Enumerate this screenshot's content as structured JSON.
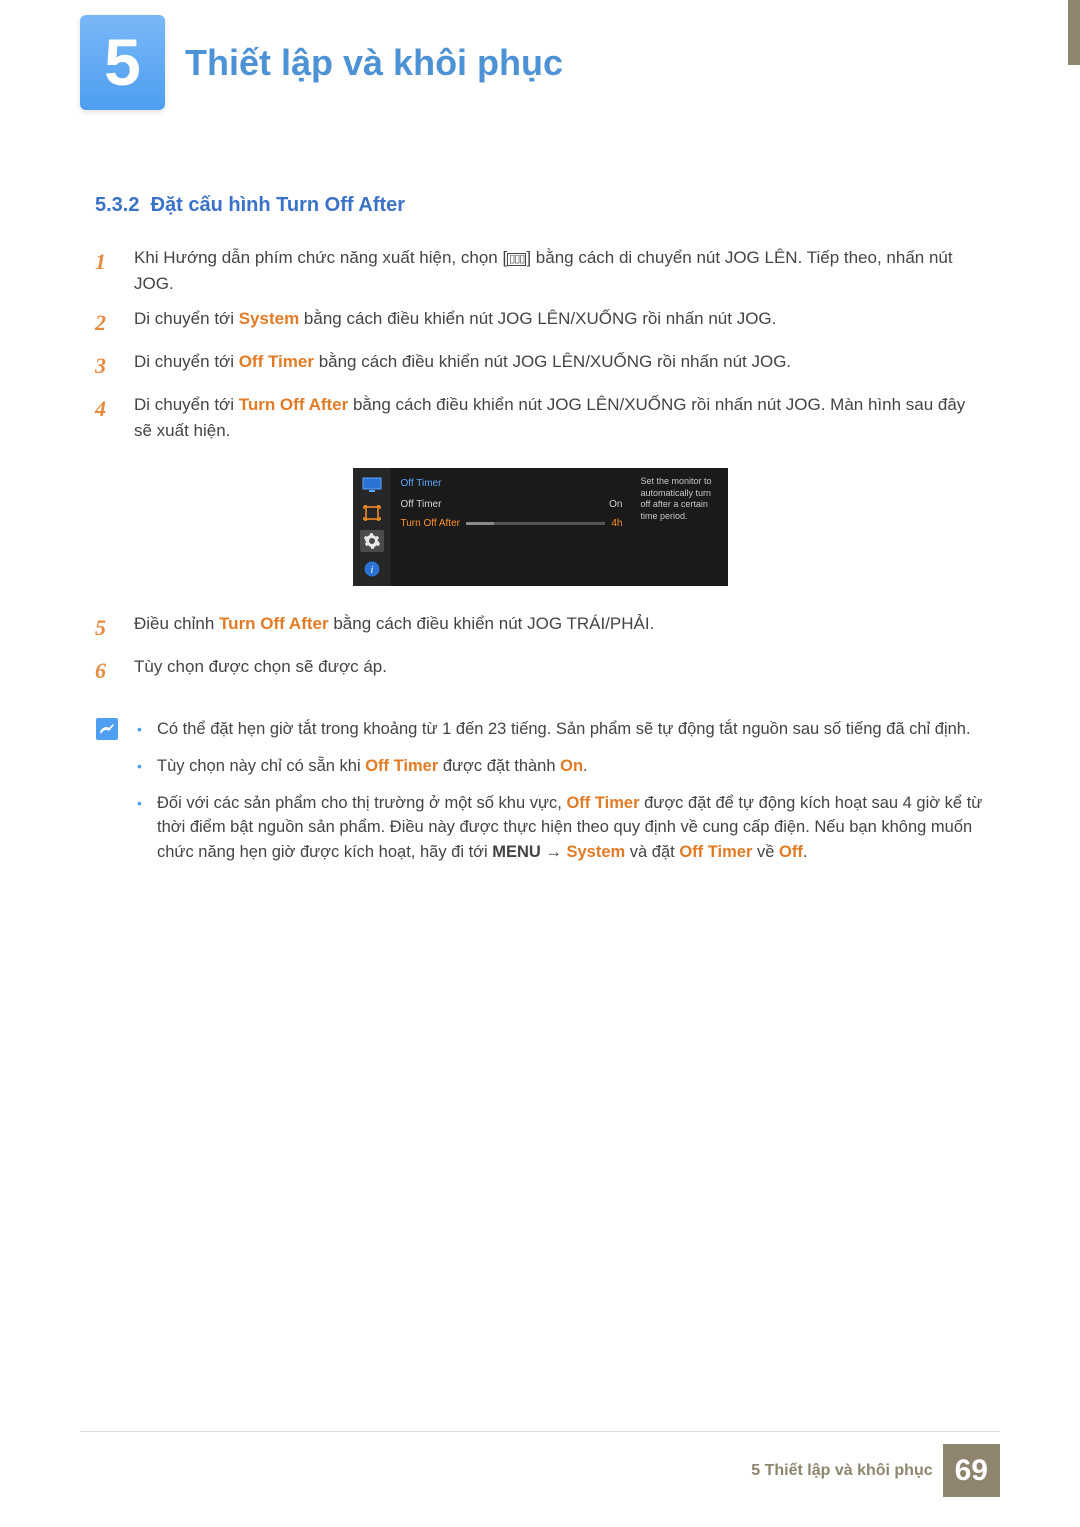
{
  "chapter": {
    "number": "5",
    "title": "Thiết lập và khôi phục"
  },
  "section": {
    "number": "5.3.2",
    "title": "Đặt cấu hình Turn Off After"
  },
  "steps": {
    "s1a": "Khi Hướng dẫn phím chức năng xuất hiện, chọn [",
    "s1b": "] bằng cách di chuyển nút JOG LÊN. Tiếp theo, nhấn nút JOG.",
    "s2a": "Di chuyển tới ",
    "s2b": " bằng cách điều khiển nút JOG LÊN/XUỐNG rồi nhấn nút JOG.",
    "s2_accent": "System",
    "s3a": "Di chuyển tới ",
    "s3_accent": "Off Timer",
    "s3b": " bằng cách điều khiển nút JOG LÊN/XUỐNG rồi nhấn nút JOG.",
    "s4a": "Di chuyển tới ",
    "s4_accent": "Turn Off After",
    "s4b": " bằng cách điều khiển nút JOG LÊN/XUỐNG rồi nhấn nút JOG. Màn hình sau đây sẽ xuất hiện.",
    "s5a": "Điều chỉnh ",
    "s5_accent": "Turn Off After",
    "s5b": " bằng cách điều khiển nút JOG TRÁI/PHẢI.",
    "s6": "Tùy chọn được chọn sẽ được áp."
  },
  "osd": {
    "heading": "Off Timer",
    "row1_label": "Off Timer",
    "row1_value": "On",
    "row2_label": "Turn Off After",
    "row2_value": "4h",
    "desc": "Set the monitor to automatically turn off after a certain time period."
  },
  "notes": {
    "n1": "Có thể đặt hẹn giờ tắt trong khoảng từ 1 đến 23 tiếng. Sản phẩm sẽ tự động tắt nguồn sau số tiếng đã chỉ định.",
    "n2a": "Tùy chọn này chỉ có sẵn khi ",
    "n2_off_timer": "Off Timer",
    "n2b": " được đặt thành ",
    "n2_on": "On",
    "n2c": ".",
    "n3a": "Đối với các sản phẩm cho thị trường ở một số khu vực, ",
    "n3_off_timer": "Off Timer",
    "n3b": " được đặt để tự động kích hoạt sau 4 giờ kể từ thời điểm bật nguồn sản phẩm. Điều này được thực hiện theo quy định về cung cấp điện. Nếu bạn không muốn chức năng hẹn giờ được kích hoạt, hãy đi tới ",
    "n3_menu": "MENU",
    "n3_arrow": " → ",
    "n3_system": "System",
    "n3c": " và đặt ",
    "n3_off_timer2": "Off Timer",
    "n3d": " về ",
    "n3_off": "Off",
    "n3e": "."
  },
  "footer": {
    "label": "5 Thiết lập và khôi phục",
    "page": "69"
  }
}
